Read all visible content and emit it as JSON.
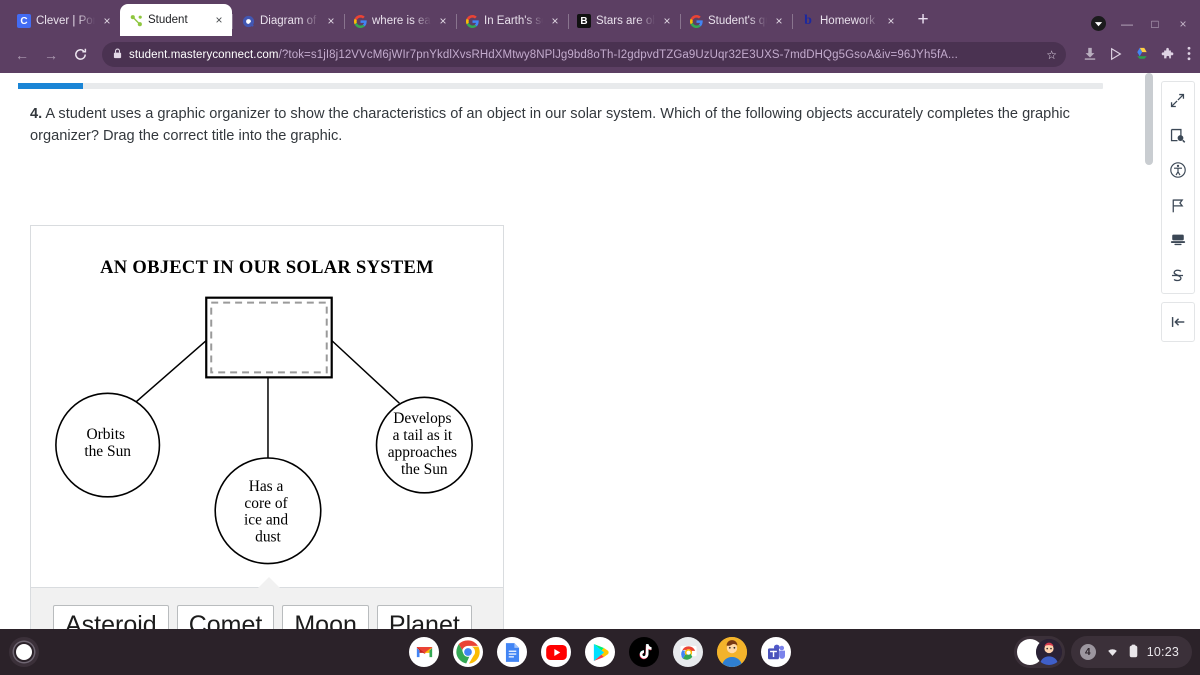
{
  "browser": {
    "tabs": [
      {
        "title": "Clever | Portal",
        "icon": "clever-favicon",
        "active": false
      },
      {
        "title": "Student",
        "icon": "masteryconnect-favicon",
        "active": true
      },
      {
        "title": "Diagram of th",
        "icon": "quizlet-favicon",
        "active": false
      },
      {
        "title": "where is earth",
        "icon": "google-favicon",
        "active": false
      },
      {
        "title": "In Earth's sola",
        "icon": "google-favicon",
        "active": false
      },
      {
        "title": "Stars are obje",
        "icon": "brainly-favicon",
        "active": false
      },
      {
        "title": "Student's quiz",
        "icon": "google-favicon",
        "active": false
      },
      {
        "title": "Homework He",
        "icon": "brainly-b-favicon",
        "active": false
      }
    ],
    "new_tab_label": "+",
    "close_label": "×",
    "window_controls": {
      "minimize": "—",
      "maximize": "□",
      "close": "×"
    },
    "address": {
      "host": "student.masteryconnect.com",
      "path": "/?tok=s1jI8j12VVcM6jWIr7pnYkdlXvsRHdXMtwy8NPlJg9bd8oTh-I2gdpvdTZGa9UzUqr32E3UXS-7mdDHQg5GsoA&iv=96JYh5fA...",
      "lock_icon": "lock-icon",
      "bookmark_icon": "star-icon"
    },
    "nav": {
      "back": "←",
      "forward": "→",
      "reload": "C"
    },
    "toolbar_icons": [
      "download-icon",
      "send-icon",
      "google-drive-icon",
      "extensions-icon",
      "chrome-menu-icon"
    ]
  },
  "assessment": {
    "progress_percent": 6,
    "question_number": "4.",
    "question_text": "A student uses a graphic organizer to show the characteristics of an object in our solar system. Which of the following objects accurately completes the graphic organizer? Drag the correct title into the graphic.",
    "organizer": {
      "title": "AN OBJECT IN OUR SOLAR SYSTEM",
      "drop_target_label": "",
      "nodes": [
        {
          "id": "left",
          "lines": [
            "Orbits",
            "the Sun"
          ]
        },
        {
          "id": "center",
          "lines": [
            "Has a",
            "core of",
            "ice and",
            "dust"
          ]
        },
        {
          "id": "right",
          "lines": [
            "Develops",
            "a tail as it",
            "approaches",
            "the Sun"
          ]
        }
      ]
    },
    "choices": [
      "Asteroid",
      "Comet",
      "Moon",
      "Planet"
    ]
  },
  "tools": {
    "items": [
      {
        "name": "expand-icon",
        "title": "Expand"
      },
      {
        "name": "magnifier-icon",
        "title": "Zoom"
      },
      {
        "name": "accessibility-icon",
        "title": "Accessibility"
      },
      {
        "name": "flag-icon",
        "title": "Flag"
      },
      {
        "name": "highlighter-icon",
        "title": "Highlighter"
      },
      {
        "name": "strikethrough-icon",
        "title": "Strikethrough"
      }
    ],
    "collapse": {
      "name": "collapse-panel-icon",
      "title": "Collapse"
    }
  },
  "shelf": {
    "launcher": "launcher-button",
    "apps": [
      "gmail-icon",
      "chrome-icon",
      "google-docs-icon",
      "youtube-icon",
      "google-play-icon",
      "tiktok-icon",
      "chrome-remote-desktop-icon",
      "avatar-icon",
      "microsoft-teams-icon"
    ],
    "tray": {
      "notification_count": "4",
      "wifi": "wifi-icon",
      "battery": "battery-icon",
      "time": "10:23"
    }
  },
  "colors": {
    "chrome_frame": "#5c3f63",
    "progress_blue": "#1a85d6",
    "shelf": "#2b2229"
  }
}
